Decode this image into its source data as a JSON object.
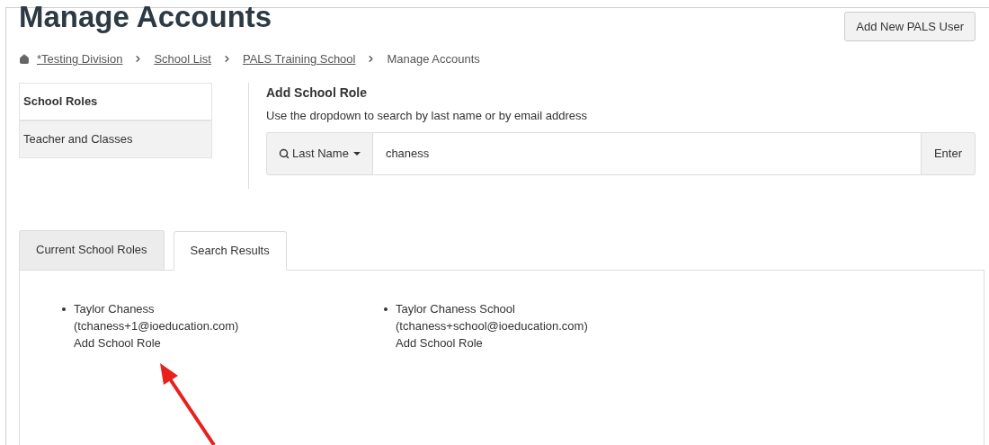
{
  "page_title": "Manage Accounts",
  "header_button": "Add New PALS User",
  "breadcrumb": [
    {
      "label": "*Testing Division",
      "link": true
    },
    {
      "label": "School List",
      "link": true
    },
    {
      "label": "PALS Training School",
      "link": true
    },
    {
      "label": "Manage Accounts",
      "link": false
    }
  ],
  "sidebar": {
    "items": [
      {
        "label": "School Roles",
        "selected": true
      },
      {
        "label": "Teacher and Classes",
        "selected": false
      }
    ]
  },
  "add_role": {
    "title": "Add School Role",
    "hint": "Use the dropdown to search by last name or by email address",
    "search_mode": "Last Name",
    "value": "chaness",
    "submit": "Enter"
  },
  "tabs": [
    {
      "label": "Current School Roles",
      "selected": false
    },
    {
      "label": "Search Results",
      "selected": true
    }
  ],
  "results": [
    {
      "name": "Taylor Chaness",
      "email": "(tchaness+1@ioeducation.com)",
      "action": "Add School Role"
    },
    {
      "name": "Taylor Chaness School",
      "email": "(tchaness+school@ioeducation.com)",
      "action": "Add School Role"
    }
  ]
}
